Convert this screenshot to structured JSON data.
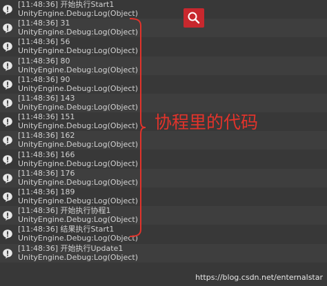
{
  "logs": [
    {
      "time": "[11:48:36]",
      "message": "开始执行Start1",
      "source": "UnityEngine.Debug:Log(Object)"
    },
    {
      "time": "[11:48:36]",
      "message": "31",
      "source": "UnityEngine.Debug:Log(Object)"
    },
    {
      "time": "[11:48:36]",
      "message": "56",
      "source": "UnityEngine.Debug:Log(Object)"
    },
    {
      "time": "[11:48:36]",
      "message": "80",
      "source": "UnityEngine.Debug:Log(Object)"
    },
    {
      "time": "[11:48:36]",
      "message": "90",
      "source": "UnityEngine.Debug:Log(Object)"
    },
    {
      "time": "[11:48:36]",
      "message": "143",
      "source": "UnityEngine.Debug:Log(Object)"
    },
    {
      "time": "[11:48:36]",
      "message": "151",
      "source": "UnityEngine.Debug:Log(Object)"
    },
    {
      "time": "[11:48:36]",
      "message": "162",
      "source": "UnityEngine.Debug:Log(Object)"
    },
    {
      "time": "[11:48:36]",
      "message": "166",
      "source": "UnityEngine.Debug:Log(Object)"
    },
    {
      "time": "[11:48:36]",
      "message": "176",
      "source": "UnityEngine.Debug:Log(Object)"
    },
    {
      "time": "[11:48:36]",
      "message": "189",
      "source": "UnityEngine.Debug:Log(Object)"
    },
    {
      "time": "[11:48:36]",
      "message": "开始执行协程1",
      "source": "UnityEngine.Debug:Log(Object)"
    },
    {
      "time": "[11:48:36]",
      "message": "结果执行Start1",
      "source": "UnityEngine.Debug:Log(Object)"
    },
    {
      "time": "[11:48:36]",
      "message": "开始执行Update1",
      "source": "UnityEngine.Debug:Log(Object)"
    }
  ],
  "icons": {
    "log_icon": "info-speech-bubble-icon",
    "search": "search-icon"
  },
  "annotation": {
    "text": "协程里的代码",
    "color": "#e2332b"
  },
  "watermark": "https://blog.csdn.net/enternalstar",
  "colors": {
    "background": "#383838",
    "row_alt": "#3e3e3e",
    "text": "#d2d2d2",
    "accent_red": "#c8282e"
  }
}
